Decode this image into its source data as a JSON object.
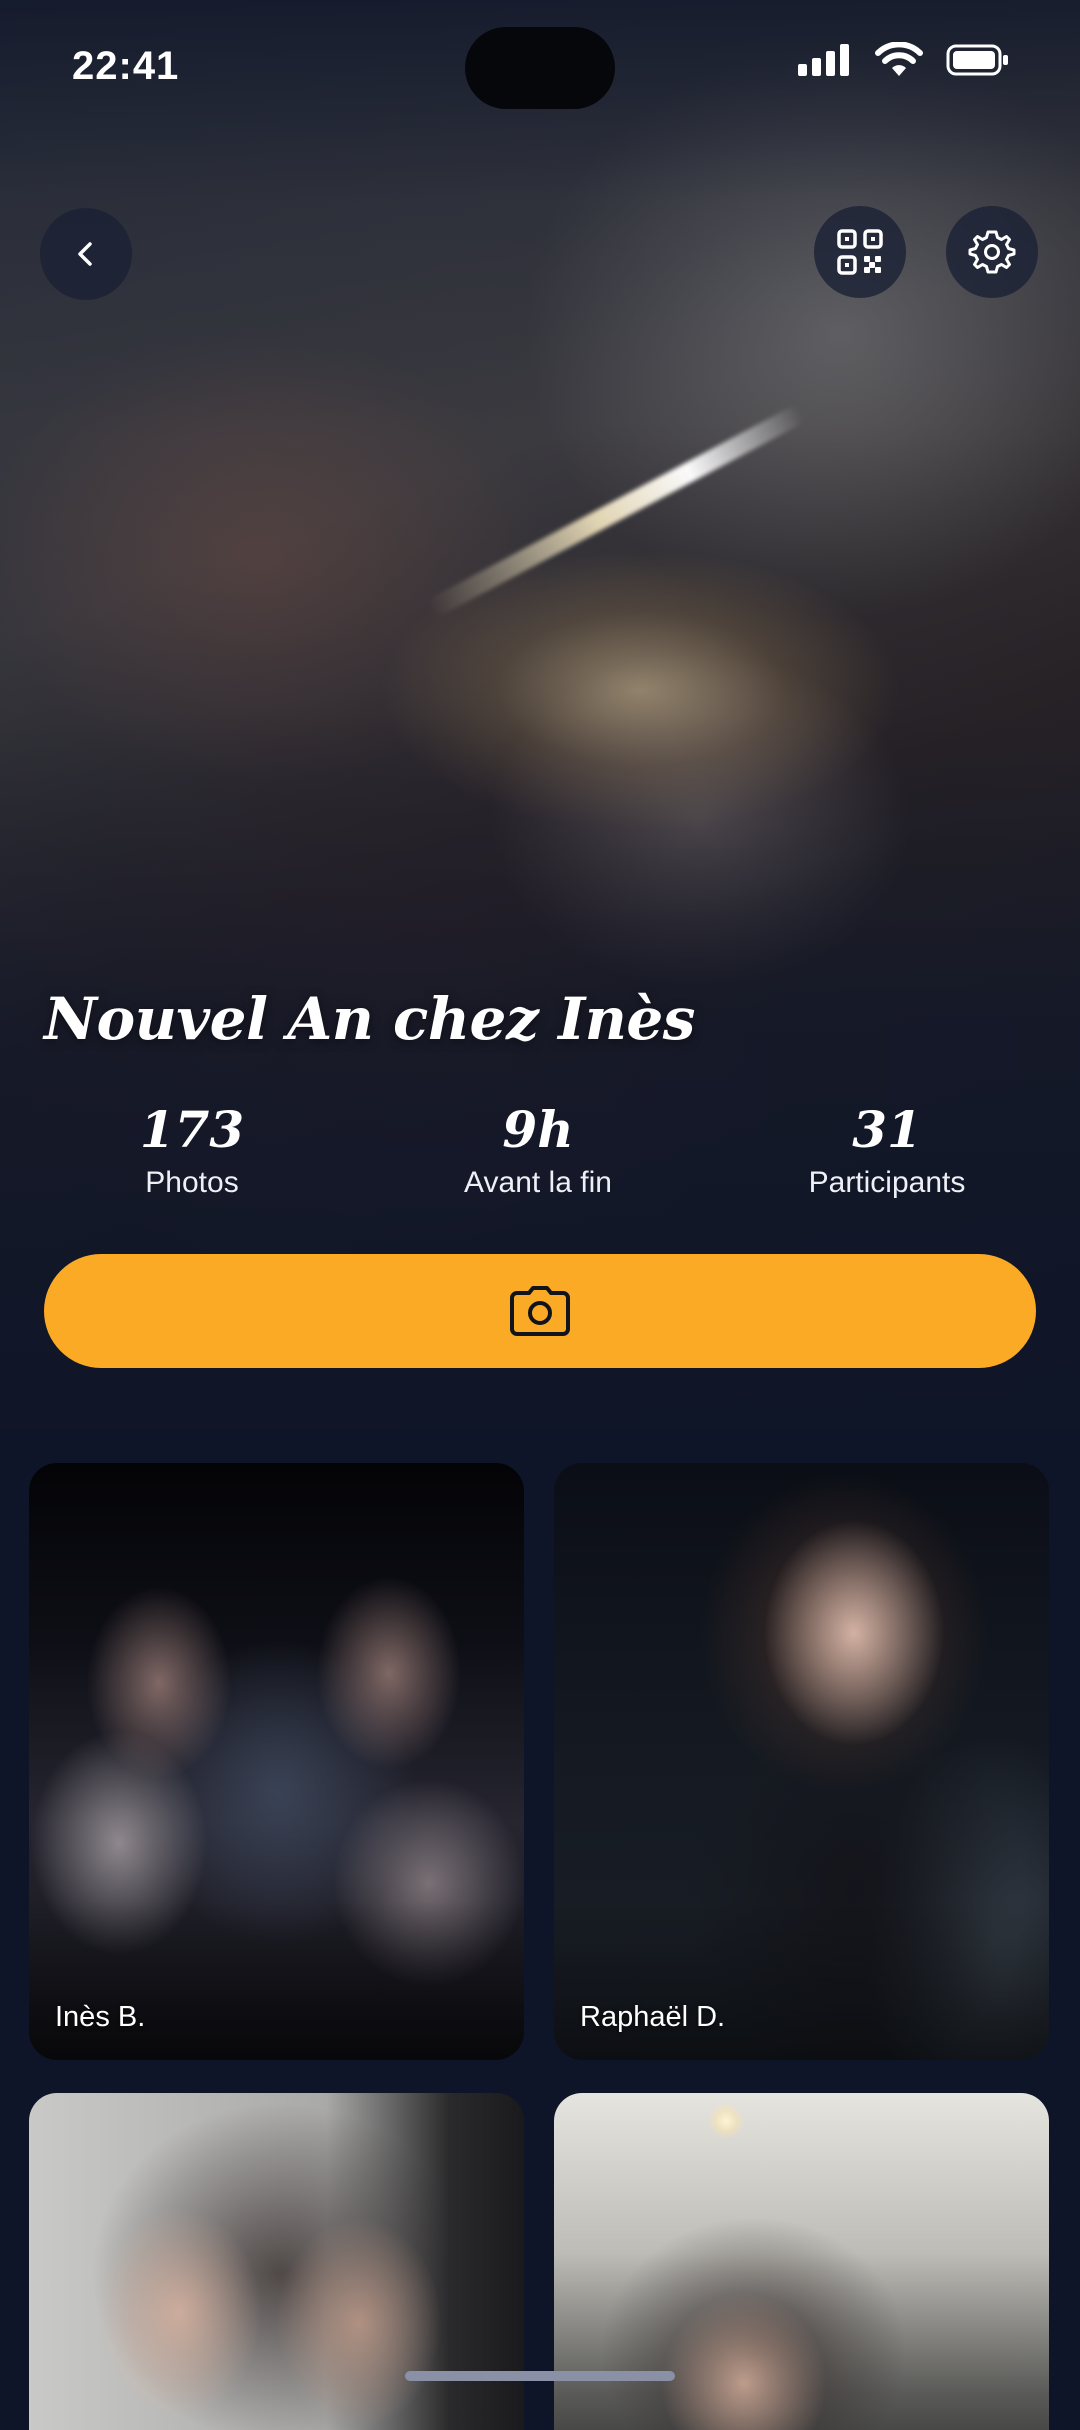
{
  "status_bar": {
    "time": "22:41",
    "icons": [
      "signal-icon",
      "wifi-icon",
      "battery-icon"
    ]
  },
  "header": {
    "back_icon": "chevron-left-icon",
    "qr_icon": "qr-code-icon",
    "settings_icon": "gear-icon"
  },
  "event": {
    "title": "Nouvel An chez Inès",
    "stats": [
      {
        "value": "173",
        "label": "Photos"
      },
      {
        "value": "9h",
        "label": "Avant la fin"
      },
      {
        "value": "31",
        "label": "Participants"
      }
    ]
  },
  "camera_button": {
    "icon": "camera-icon",
    "color": "#fbaa25"
  },
  "photos": [
    {
      "author": "Inès B."
    },
    {
      "author": "Raphaël D."
    },
    {
      "author": ""
    },
    {
      "author": ""
    }
  ],
  "colors": {
    "background": "#0e1528",
    "accent": "#fbaa25"
  }
}
